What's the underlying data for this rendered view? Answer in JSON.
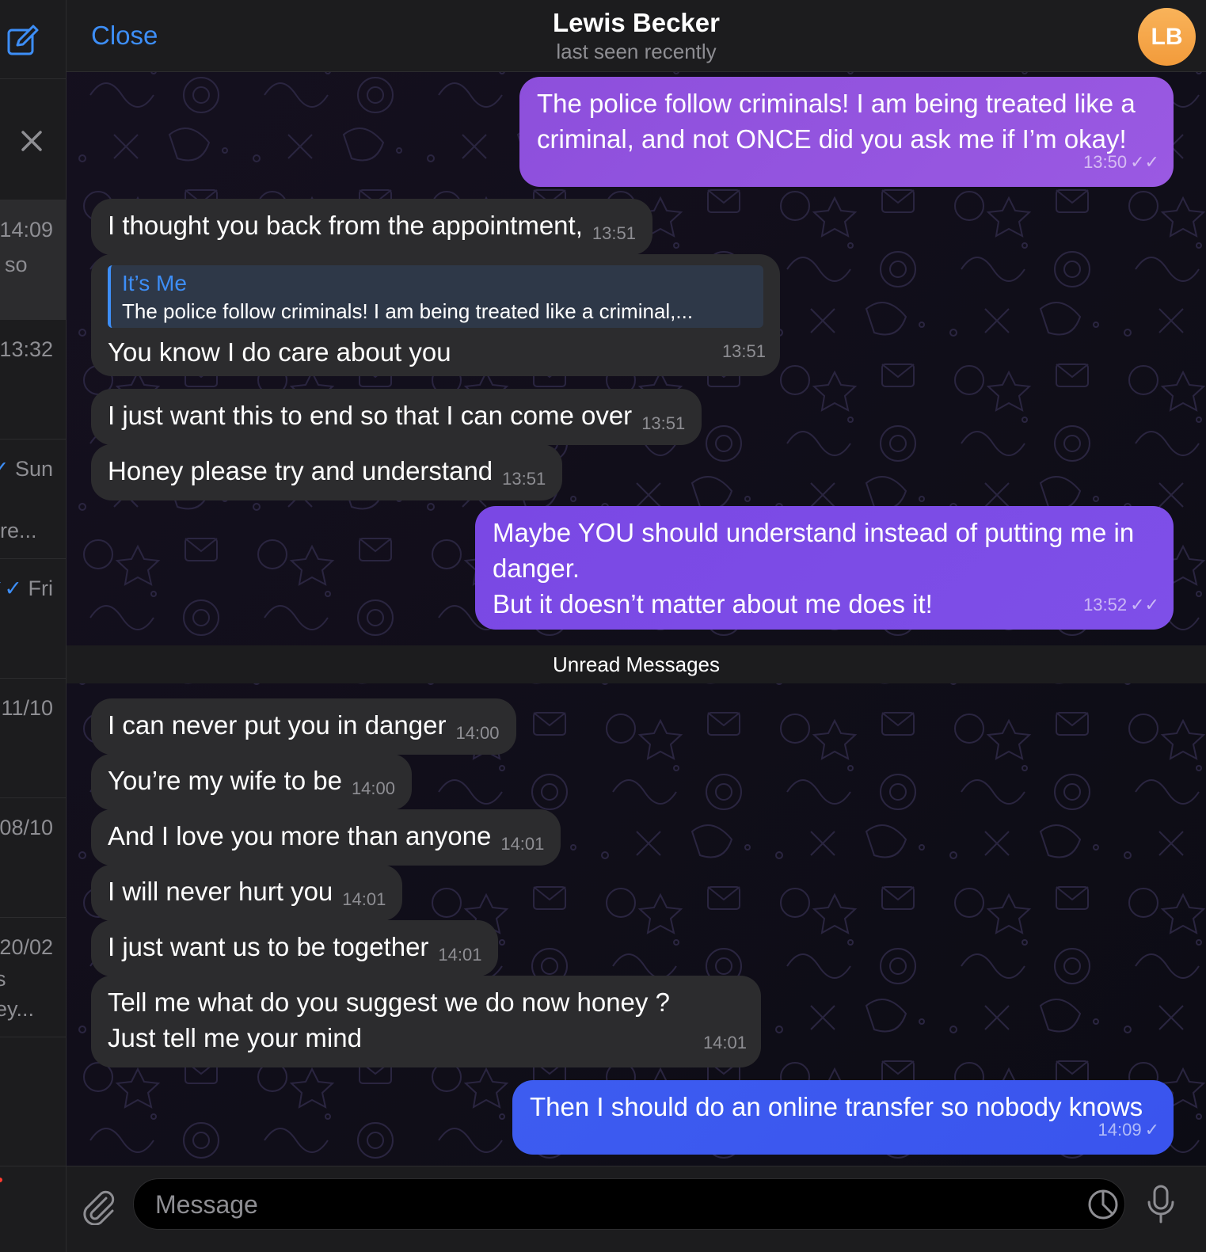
{
  "colors": {
    "accent": "#3d8ef7",
    "outgoing_purple": "#8a4fe0",
    "outgoing_blue": "#3d5cf0",
    "incoming": "#2c2c2e",
    "avatar": "#f2a447"
  },
  "sidebar": {
    "compose_icon": "compose-icon",
    "close_icon": "close-icon",
    "rows": [
      {
        "time": "14:09",
        "snippet": "so"
      },
      {
        "time": "13:32",
        "snippet": ""
      },
      {
        "time": "Sun",
        "snippet": "re..."
      },
      {
        "time": "Fri",
        "snippet": ""
      },
      {
        "time": "11/10",
        "snippet": ""
      },
      {
        "time": "08/10",
        "snippet": ""
      },
      {
        "time": "20/02",
        "snippet": "s",
        "snippet2": "ey..."
      }
    ]
  },
  "header": {
    "close_label": "Close",
    "name": "Lewis Becker",
    "status": "last seen recently",
    "avatar_initials": "LB"
  },
  "messages": [
    {
      "dir": "out",
      "text": "The police follow criminals! I am being treated like a criminal, and not ONCE did you ask me if I’m okay!",
      "time": "13:50",
      "status": "read"
    },
    {
      "dir": "in",
      "text": "I thought you back from the appointment,",
      "time": "13:51"
    },
    {
      "dir": "in",
      "reply_name": "It’s Me",
      "reply_text": "The police follow criminals! I am being treated like a criminal,...",
      "text": "You know I do care about you",
      "time": "13:51"
    },
    {
      "dir": "in",
      "text": "I just want this to end so that I can come over",
      "time": "13:51"
    },
    {
      "dir": "in",
      "text": "Honey please try and understand",
      "time": "13:51"
    },
    {
      "dir": "out",
      "text": "Maybe YOU should understand instead of putting me in danger.",
      "text2": "But it doesn’t matter about me does it!",
      "time": "13:52",
      "status": "read"
    },
    {
      "dir": "in",
      "text": "I can never put you in danger",
      "time": "14:00"
    },
    {
      "dir": "in",
      "text": "You’re my wife to be",
      "time": "14:00"
    },
    {
      "dir": "in",
      "text": "And I love you more than anyone",
      "time": "14:01"
    },
    {
      "dir": "in",
      "text": "I will never hurt you",
      "time": "14:01"
    },
    {
      "dir": "in",
      "text": "I just want us to be together",
      "time": "14:01"
    },
    {
      "dir": "in",
      "text": "Tell me what do you suggest we do now honey ? Just tell me your mind",
      "time": "14:01"
    },
    {
      "dir": "out",
      "text": "Then I should do an online transfer so nobody knows",
      "time": "14:09",
      "status": "sent"
    }
  ],
  "unread_label": "Unread Messages",
  "input": {
    "placeholder": "Message",
    "value": ""
  }
}
